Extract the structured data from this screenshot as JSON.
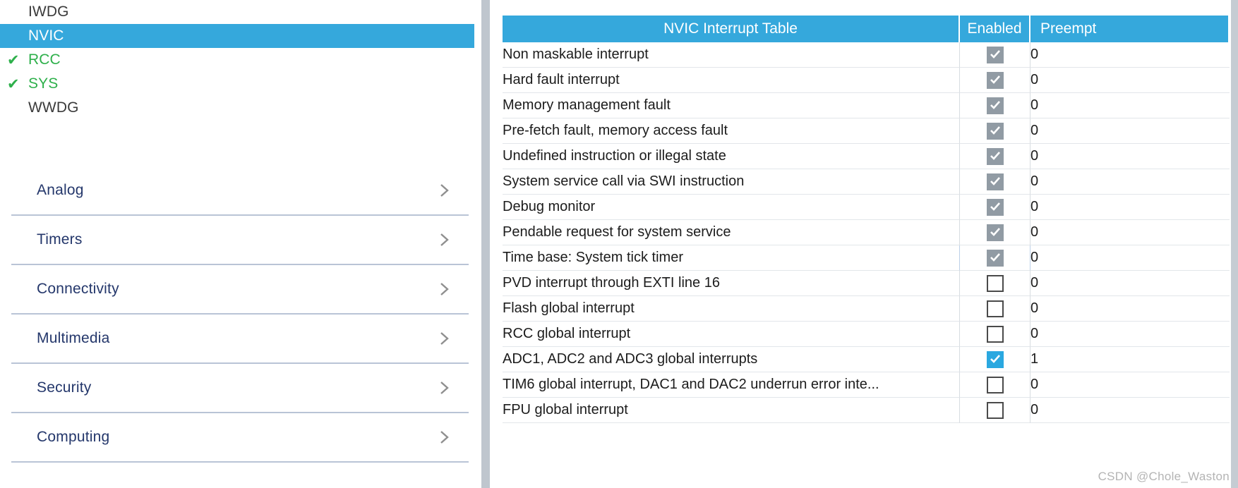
{
  "sidebar": {
    "peripherals": [
      {
        "label": "IWDG",
        "configured": false,
        "selected": false
      },
      {
        "label": "NVIC",
        "configured": false,
        "selected": true
      },
      {
        "label": "RCC",
        "configured": true,
        "selected": false
      },
      {
        "label": "SYS",
        "configured": true,
        "selected": false
      },
      {
        "label": "WWDG",
        "configured": false,
        "selected": false
      }
    ],
    "check_icon": "✔",
    "categories": [
      {
        "label": "Analog",
        "chevron": "chevron-right-icon"
      },
      {
        "label": "Timers",
        "chevron": "chevron-right-icon"
      },
      {
        "label": "Connectivity",
        "chevron": "chevron-right-icon"
      },
      {
        "label": "Multimedia",
        "chevron": "chevron-right-icon"
      },
      {
        "label": "Security",
        "chevron": "chevron-right-icon"
      },
      {
        "label": "Computing",
        "chevron": "chevron-right-icon"
      }
    ]
  },
  "table": {
    "columns": {
      "name": "NVIC Interrupt Table",
      "enabled": "Enabled",
      "preempt": "Preempt"
    },
    "rows": [
      {
        "name": "Non maskable interrupt",
        "enabled": "checked-disabled",
        "preempt": "0",
        "preempt_dim": true,
        "selected": false
      },
      {
        "name": "Hard fault interrupt",
        "enabled": "checked-disabled",
        "preempt": "0",
        "preempt_dim": true,
        "selected": false
      },
      {
        "name": "Memory management fault",
        "enabled": "checked-disabled",
        "preempt": "0",
        "preempt_dim": false,
        "selected": false
      },
      {
        "name": "Pre-fetch fault, memory access fault",
        "enabled": "checked-disabled",
        "preempt": "0",
        "preempt_dim": false,
        "selected": false
      },
      {
        "name": "Undefined instruction or illegal state",
        "enabled": "checked-disabled",
        "preempt": "0",
        "preempt_dim": false,
        "selected": false
      },
      {
        "name": "System service call via SWI instruction",
        "enabled": "checked-disabled",
        "preempt": "0",
        "preempt_dim": false,
        "selected": false
      },
      {
        "name": "Debug monitor",
        "enabled": "checked-disabled",
        "preempt": "0",
        "preempt_dim": false,
        "selected": false
      },
      {
        "name": "Pendable request for system service",
        "enabled": "checked-disabled",
        "preempt": "0",
        "preempt_dim": false,
        "selected": false
      },
      {
        "name": "Time base: System tick timer",
        "enabled": "checked-disabled",
        "preempt": "0",
        "preempt_dim": false,
        "selected": true
      },
      {
        "name": "PVD interrupt through EXTI line 16",
        "enabled": "unchecked",
        "preempt": "0",
        "preempt_dim": false,
        "selected": false
      },
      {
        "name": "Flash global interrupt",
        "enabled": "unchecked",
        "preempt": "0",
        "preempt_dim": false,
        "selected": false
      },
      {
        "name": "RCC global interrupt",
        "enabled": "unchecked",
        "preempt": "0",
        "preempt_dim": false,
        "selected": false
      },
      {
        "name": "ADC1, ADC2 and ADC3 global interrupts",
        "enabled": "checked-active",
        "preempt": "1",
        "preempt_dim": false,
        "selected": false
      },
      {
        "name": "TIM6 global interrupt, DAC1 and DAC2 underrun error inte...",
        "enabled": "unchecked",
        "preempt": "0",
        "preempt_dim": false,
        "selected": false
      },
      {
        "name": "FPU global interrupt",
        "enabled": "unchecked",
        "preempt": "0",
        "preempt_dim": false,
        "selected": false
      }
    ]
  },
  "watermark": "CSDN @Chole_Waston",
  "colors": {
    "accent": "#35a8dc",
    "configured_green": "#2eb04b",
    "selected_row": "#bcd0e8",
    "category_text": "#24376b",
    "disabled_checkbox": "#919ba4"
  }
}
